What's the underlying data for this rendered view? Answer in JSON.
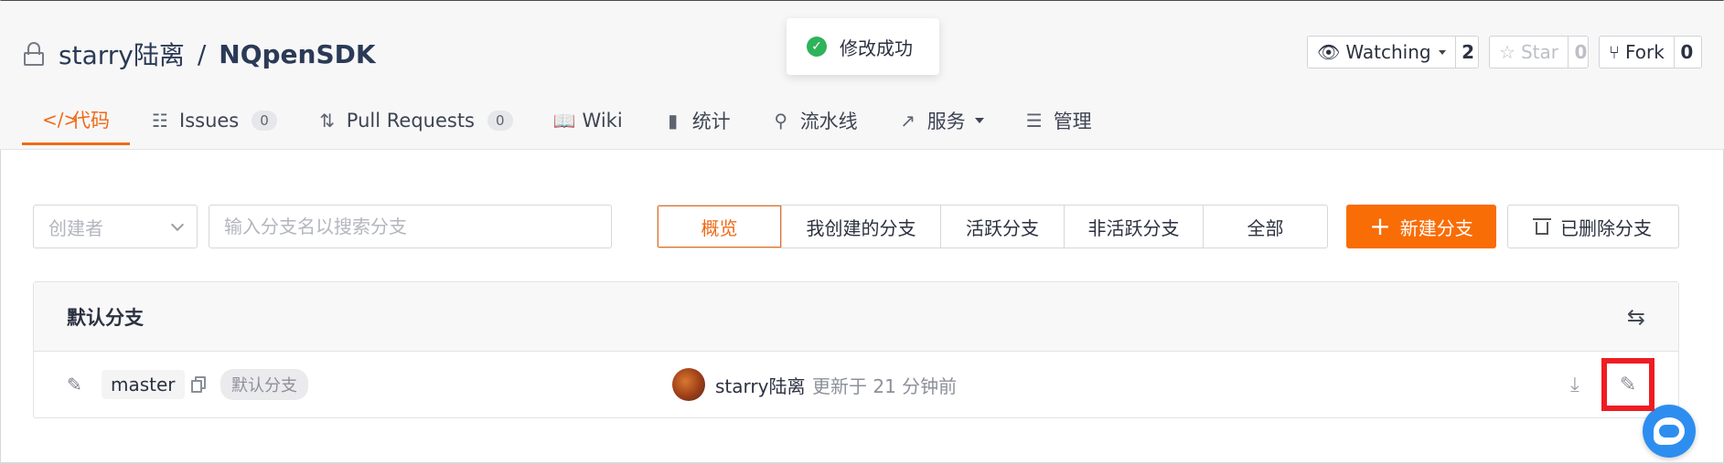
{
  "repo": {
    "owner": "starry陆离",
    "separator": "/",
    "name": "NQpenSDK"
  },
  "social": {
    "watch_label": "Watching",
    "watch_count": "2",
    "star_label": "Star",
    "star_count": "0",
    "fork_label": "Fork",
    "fork_count": "0"
  },
  "nav": {
    "items": [
      {
        "label": "代码",
        "icon": "code-icon",
        "active": true
      },
      {
        "label": "Issues",
        "icon": "issues-icon",
        "badge": "0"
      },
      {
        "label": "Pull Requests",
        "icon": "pull-request-icon",
        "badge": "0"
      },
      {
        "label": "Wiki",
        "icon": "wiki-book-icon"
      },
      {
        "label": "统计",
        "icon": "stats-bar-icon"
      },
      {
        "label": "流水线",
        "icon": "pipeline-icon"
      },
      {
        "label": "服务",
        "icon": "service-chart-icon",
        "dropdown": true
      },
      {
        "label": "管理",
        "icon": "manage-doc-icon"
      }
    ]
  },
  "toast": {
    "message": "修改成功",
    "icon": "check-circle-icon",
    "color": "#2fb35a"
  },
  "filters": {
    "creator_placeholder": "创建者",
    "search_placeholder": "输入分支名以搜索分支"
  },
  "tabs": [
    {
      "label": "概览",
      "active": true
    },
    {
      "label": "我创建的分支"
    },
    {
      "label": "活跃分支"
    },
    {
      "label": "非活跃分支"
    },
    {
      "label": "全部"
    }
  ],
  "actions": {
    "new_branch": "新建分支",
    "deleted_branches": "已删除分支",
    "accent": "#f96d06"
  },
  "default_branch": {
    "section_title": "默认分支",
    "name": "master",
    "badge": "默认分支",
    "author": "starry陆离",
    "updated": "更新于 21 分钟前"
  }
}
